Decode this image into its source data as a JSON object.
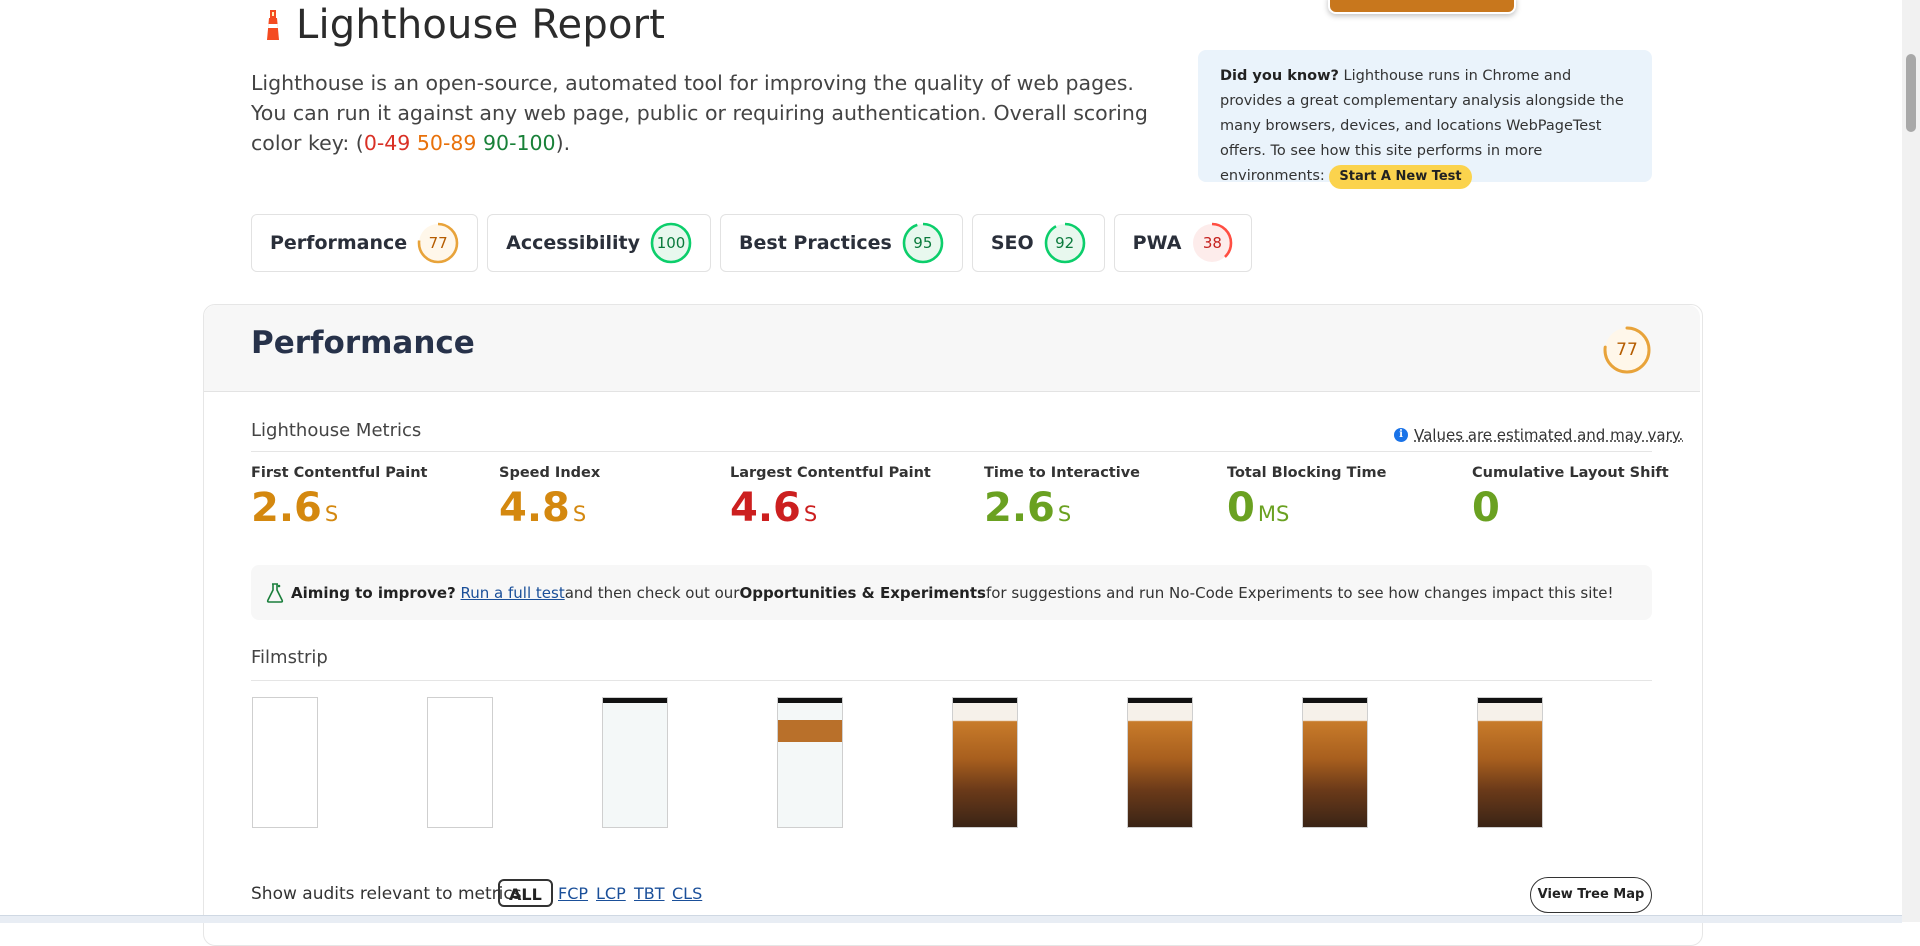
{
  "header": {
    "title": "Lighthouse Report",
    "intro_text": "Lighthouse is an open-source, automated tool for improving the quality of web pages. You can run it against any web page, public or requiring authentication. Overall scoring color key: (",
    "key_red": "0-49",
    "key_orange": "50-89",
    "key_green": "90-100",
    "intro_end": ")."
  },
  "did_you_know": {
    "heading": "Did you know?",
    "text": " Lighthouse runs in Chrome and provides a great complementary analysis alongside the many browsers, devices, and locations WebPageTest offers. To see how this site performs in more environments: ",
    "button": "Start A New Test"
  },
  "categories": [
    {
      "label": "Performance",
      "score": "77",
      "fraction": 0.77,
      "color": "#e8a33a",
      "bg": "#fff7ea"
    },
    {
      "label": "Accessibility",
      "score": "100",
      "fraction": 1.0,
      "color": "#0cce6b",
      "bg": "#e8f8ee"
    },
    {
      "label": "Best Practices",
      "score": "95",
      "fraction": 0.95,
      "color": "#0cce6b",
      "bg": "#e8f8ee"
    },
    {
      "label": "SEO",
      "score": "92",
      "fraction": 0.92,
      "color": "#0cce6b",
      "bg": "#e8f8ee"
    },
    {
      "label": "PWA",
      "score": "38",
      "fraction": 0.38,
      "color": "#ff4e42",
      "bg": "#fdeceb"
    }
  ],
  "performance": {
    "title": "Performance",
    "score": "77",
    "fraction": 0.77,
    "metrics_heading": "Lighthouse Metrics",
    "estimate_note": "Values are estimated and may vary.",
    "metrics": [
      {
        "name": "First Contentful Paint",
        "value": "2.6",
        "unit": "S",
        "status": "orange"
      },
      {
        "name": "Speed Index",
        "value": "4.8",
        "unit": "S",
        "status": "orange"
      },
      {
        "name": "Largest Contentful Paint",
        "value": "4.6",
        "unit": "S",
        "status": "red"
      },
      {
        "name": "Time to Interactive",
        "value": "2.6",
        "unit": "S",
        "status": "green"
      },
      {
        "name": "Total Blocking Time",
        "value": "0",
        "unit": "MS",
        "status": "green"
      },
      {
        "name": "Cumulative Layout Shift",
        "value": "0",
        "unit": "",
        "status": "green"
      }
    ],
    "aim": {
      "lead": "Aiming to improve?",
      "link": "Run a full test",
      "mid": " and then check out our ",
      "bold": "Opportunities & Experiments",
      "tail": " for suggestions and run No-Code Experiments to see how changes impact this site!"
    },
    "filmstrip_heading": "Filmstrip",
    "filmstrip_frames": [
      "blank",
      "blank",
      "loading",
      "partial",
      "full",
      "full",
      "full",
      "full"
    ],
    "audits_label": "Show audits relevant to metrics:",
    "audit_chips": [
      "ALL",
      "FCP",
      "LCP",
      "TBT",
      "CLS"
    ],
    "tree_map_button": "View Tree Map"
  }
}
